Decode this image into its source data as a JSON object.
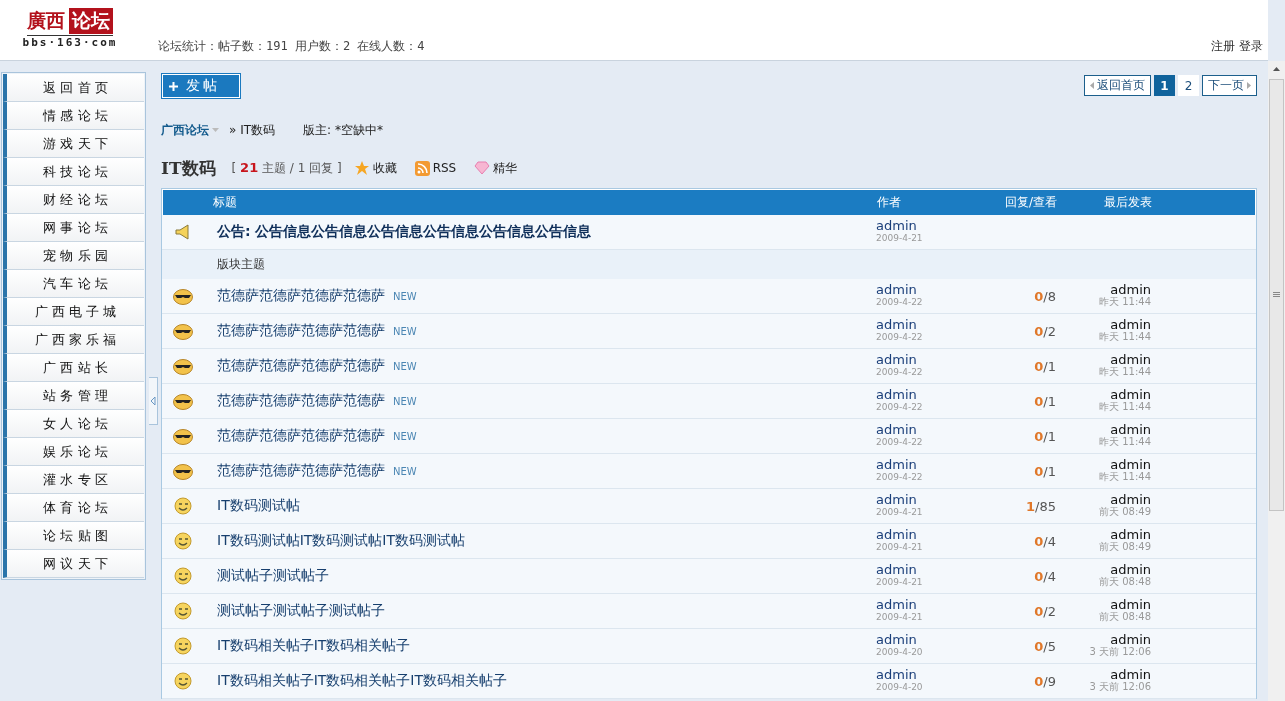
{
  "logo": {
    "title_part": "廣西",
    "title_box": "论坛",
    "domain": "bbs·163·com"
  },
  "stats": "论坛统计：帖子数：191 用户数：2 在线人数：4",
  "user_links": [
    "注册",
    "登录"
  ],
  "sidebar": {
    "items": [
      "返 回 首 页",
      "情 感 论 坛",
      "游 戏 天 下",
      "科 技 论 坛",
      "财 经 论 坛",
      "网 事 论 坛",
      "宠 物 乐 园",
      "汽 车 论 坛",
      "广 西 电 子 城",
      "广 西 家 乐 福",
      "广 西 站 长",
      "站 务 管 理",
      "女 人 论 坛",
      "娱 乐 论 坛",
      "灌 水 专 区",
      "体 育 论 坛",
      "论 坛 贴 图",
      "网 议 天 下"
    ]
  },
  "post_button": "发帖",
  "pagination": {
    "back": "返回首页",
    "pages": [
      {
        "label": "1",
        "selected": true
      },
      {
        "label": "2",
        "selected": false
      }
    ],
    "next": "下一页"
  },
  "breadcrumb": {
    "root": "广西论坛",
    "current": "» IT数码",
    "moderator": "版主: *空缺中*"
  },
  "forum": {
    "title": "IT数码",
    "summary": "[ **21** 主题 / 1 回复 ]",
    "actions": [
      {
        "kind": "favorite",
        "label": "收藏"
      },
      {
        "kind": "rss",
        "label": "RSS"
      },
      {
        "kind": "digest",
        "label": "精华"
      }
    ]
  },
  "table": {
    "columns": [
      "标题",
      "作者",
      "回复/查看",
      "最后发表"
    ],
    "announcement": {
      "title": "公告: 公告信息公告信息公告信息公告信息公告信息公告信息",
      "author": "admin",
      "date": "2009-4-21"
    },
    "section_label": "版块主题",
    "rows": [
      {
        "kind": "cool",
        "title": "范德萨范德萨范德萨范德萨",
        "badge": "NEW",
        "author": "admin",
        "date": "2009-4-22",
        "stats": "**0**/8",
        "last_author": "admin",
        "last_time": "昨天 11:44"
      },
      {
        "kind": "cool",
        "title": "范德萨范德萨范德萨范德萨",
        "badge": "NEW",
        "author": "admin",
        "date": "2009-4-22",
        "stats": "**0**/2",
        "last_author": "admin",
        "last_time": "昨天 11:44"
      },
      {
        "kind": "cool",
        "title": "范德萨范德萨范德萨范德萨",
        "badge": "NEW",
        "author": "admin",
        "date": "2009-4-22",
        "stats": "**0**/1",
        "last_author": "admin",
        "last_time": "昨天 11:44"
      },
      {
        "kind": "cool",
        "title": "范德萨范德萨范德萨范德萨",
        "badge": "NEW",
        "author": "admin",
        "date": "2009-4-22",
        "stats": "**0**/1",
        "last_author": "admin",
        "last_time": "昨天 11:44"
      },
      {
        "kind": "cool",
        "title": "范德萨范德萨范德萨范德萨",
        "badge": "NEW",
        "author": "admin",
        "date": "2009-4-22",
        "stats": "**0**/1",
        "last_author": "admin",
        "last_time": "昨天 11:44"
      },
      {
        "kind": "cool",
        "title": "范德萨范德萨范德萨范德萨",
        "badge": "NEW",
        "author": "admin",
        "date": "2009-4-22",
        "stats": "**0**/1",
        "last_author": "admin",
        "last_time": "昨天 11:44"
      },
      {
        "kind": "smile",
        "title": "IT数码测试帖",
        "author": "admin",
        "date": "2009-4-21",
        "stats": "**1**/85",
        "last_author": "admin",
        "last_time": "前天 08:49"
      },
      {
        "kind": "smile",
        "title": "IT数码测试帖IT数码测试帖IT数码测试帖",
        "author": "admin",
        "date": "2009-4-21",
        "stats": "**0**/4",
        "last_author": "admin",
        "last_time": "前天 08:49"
      },
      {
        "kind": "smile",
        "title": "测试帖子测试帖子",
        "author": "admin",
        "date": "2009-4-21",
        "stats": "**0**/4",
        "last_author": "admin",
        "last_time": "前天 08:48"
      },
      {
        "kind": "smile",
        "title": "测试帖子测试帖子测试帖子",
        "author": "admin",
        "date": "2009-4-21",
        "stats": "**0**/2",
        "last_author": "admin",
        "last_time": "前天 08:48"
      },
      {
        "kind": "smile",
        "title": "IT数码相关帖子IT数码相关帖子",
        "author": "admin",
        "date": "2009-4-20",
        "stats": "**0**/5",
        "last_author": "admin",
        "last_time": "3 天前 12:06"
      },
      {
        "kind": "smile",
        "title": "IT数码相关帖子IT数码相关帖子IT数码相关帖子",
        "author": "admin",
        "date": "2009-4-20",
        "stats": "**0**/9",
        "last_author": "admin",
        "last_time": "3 天前 12:06"
      }
    ]
  }
}
